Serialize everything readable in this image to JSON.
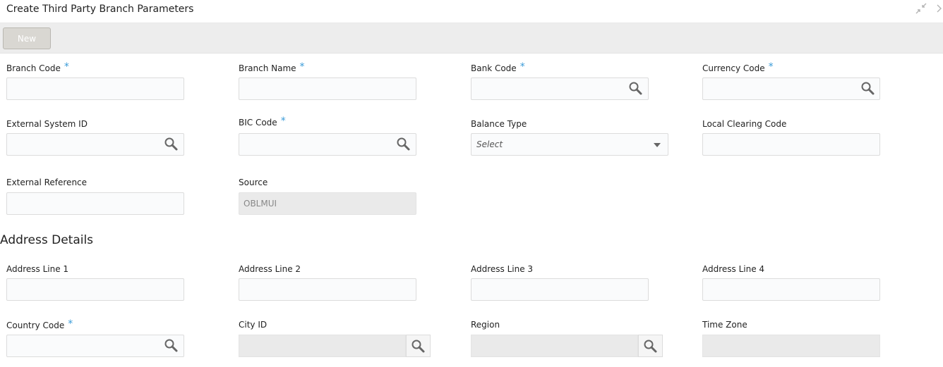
{
  "window": {
    "title": "Create Third Party Branch Parameters",
    "minimize_icon": "collapse-arrows-icon",
    "close_icon": "chevron-right-icon"
  },
  "toolbar": {
    "new_label": "New"
  },
  "form": {
    "branch_code": {
      "label": "Branch Code",
      "required": "*"
    },
    "branch_name": {
      "label": "Branch Name",
      "required": "*"
    },
    "bank_code": {
      "label": "Bank Code",
      "required": "*"
    },
    "currency_code": {
      "label": "Currency Code",
      "required": "*"
    },
    "external_system_id": {
      "label": "External System ID"
    },
    "bic_code": {
      "label": "BIC Code",
      "required": "*"
    },
    "balance_type": {
      "label": "Balance Type",
      "placeholder": "Select"
    },
    "local_clearing_code": {
      "label": "Local Clearing Code"
    },
    "external_reference": {
      "label": "External Reference"
    },
    "source": {
      "label": "Source",
      "value": "OBLMUI"
    }
  },
  "address": {
    "section_title": "Address Details",
    "line1": {
      "label": "Address Line 1"
    },
    "line2": {
      "label": "Address Line 2"
    },
    "line3": {
      "label": "Address Line 3"
    },
    "line4": {
      "label": "Address Line 4"
    },
    "country_code": {
      "label": "Country Code",
      "required": "*"
    },
    "city_id": {
      "label": "City ID"
    },
    "region": {
      "label": "Region"
    },
    "time_zone": {
      "label": "Time Zone"
    }
  },
  "colors": {
    "required_marker": "#3a9bd8",
    "toolbar_bg": "#ededed",
    "readonly_bg": "#eaeaea"
  }
}
